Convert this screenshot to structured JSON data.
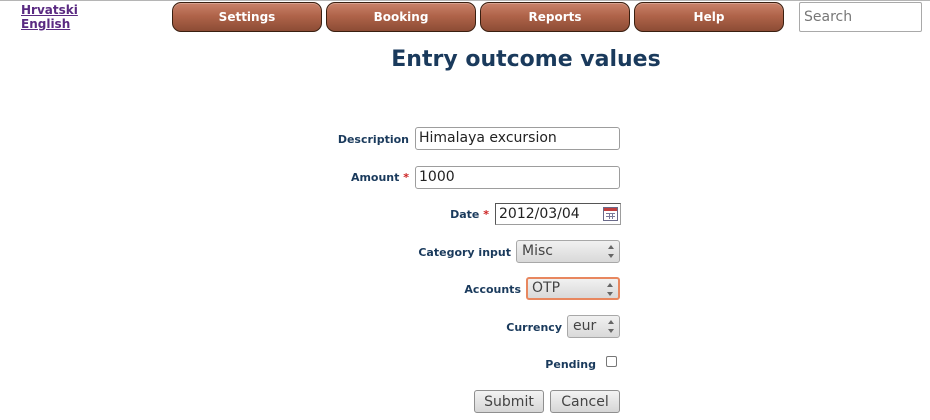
{
  "languages": [
    "Hrvatski",
    "English"
  ],
  "nav": [
    {
      "label": "Settings"
    },
    {
      "label": "Booking"
    },
    {
      "label": "Reports"
    },
    {
      "label": "Help"
    }
  ],
  "search": {
    "placeholder": "Search",
    "value": ""
  },
  "page_title": "Entry outcome values",
  "form": {
    "description": {
      "label": "Description",
      "value": "Himalaya excursion"
    },
    "amount": {
      "label": "Amount",
      "required_mark": "*",
      "value": "1000"
    },
    "date": {
      "label": "Date",
      "required_mark": "*",
      "value": "2012/03/04",
      "icon": "calendar-icon"
    },
    "category": {
      "label": "Category input",
      "value": "Misc"
    },
    "accounts": {
      "label": "Accounts",
      "value": "OTP"
    },
    "currency": {
      "label": "Currency",
      "value": "eur"
    },
    "pending": {
      "label": "Pending",
      "checked": false
    },
    "submit_label": "Submit",
    "cancel_label": "Cancel"
  },
  "colors": {
    "nav_button": "#a85c40",
    "title": "#1a3a5c",
    "required": "#cc2222",
    "focus_border": "#e8875f",
    "link": "#5a2a82"
  }
}
